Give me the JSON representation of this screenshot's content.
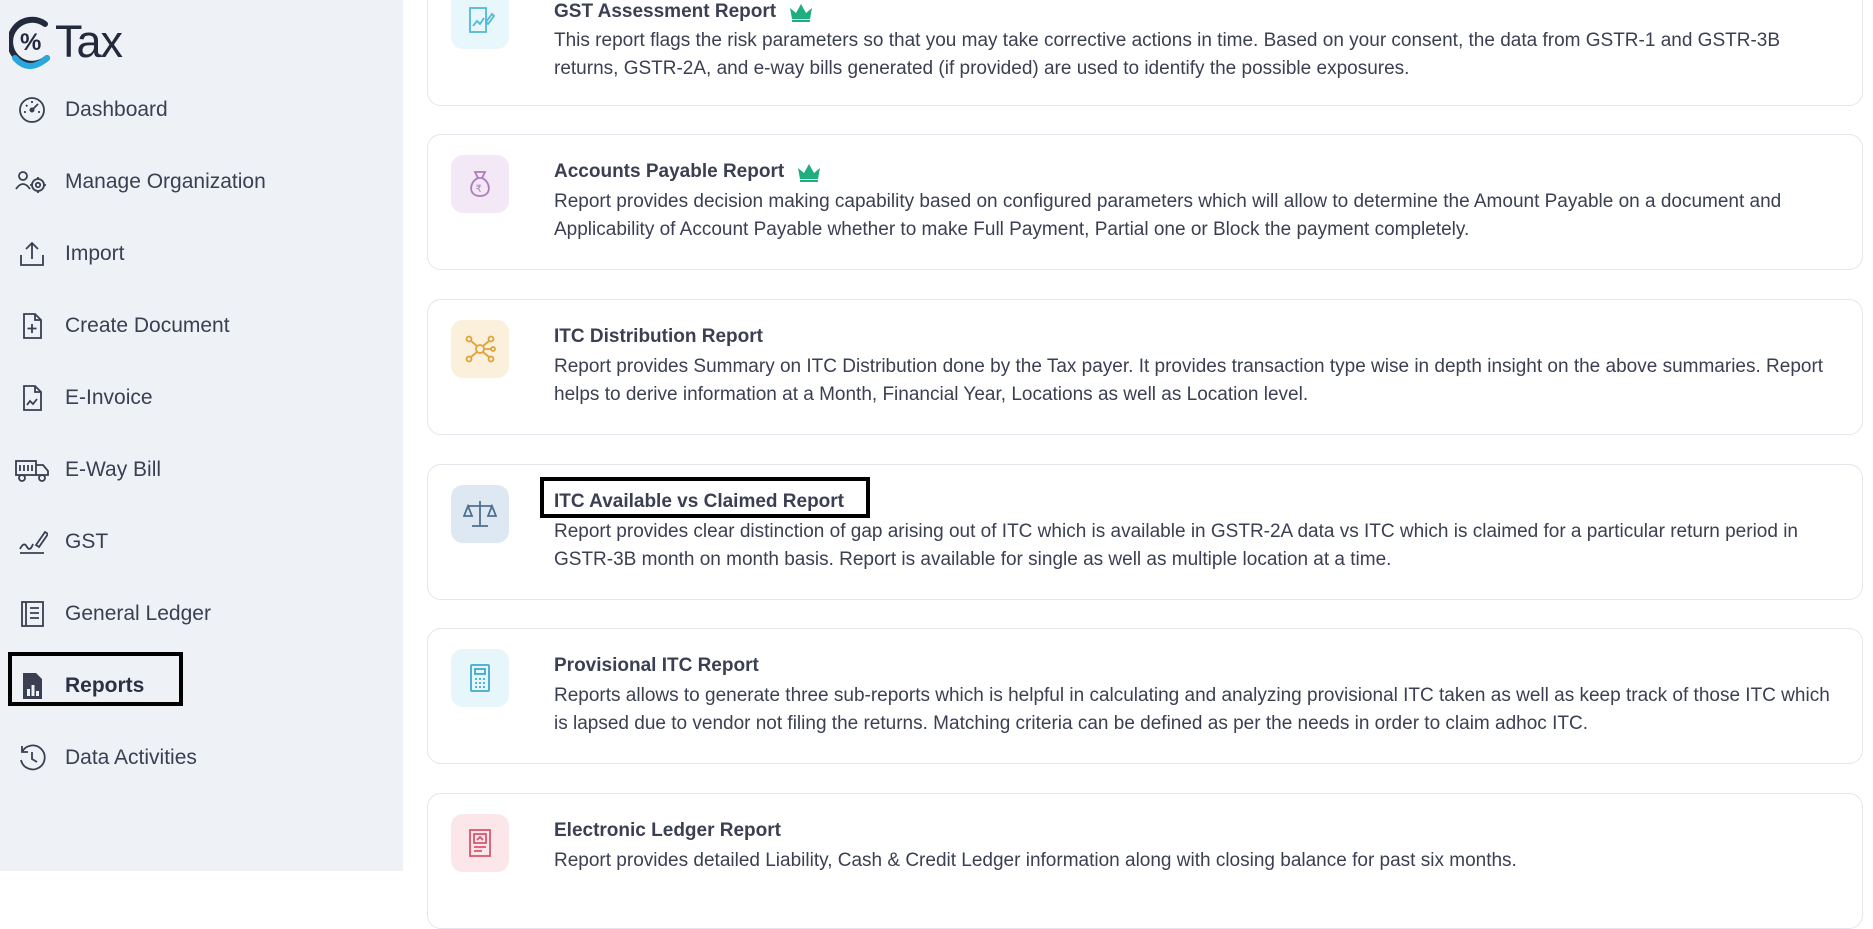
{
  "app": {
    "logo_text": "Tax",
    "logo_mark": "%"
  },
  "sidebar": {
    "items": [
      {
        "label": "Dashboard",
        "icon": "dashboard-gauge-icon"
      },
      {
        "label": "Manage Organization",
        "icon": "manage-organization-icon"
      },
      {
        "label": "Import",
        "icon": "import-upload-icon"
      },
      {
        "label": "Create Document",
        "icon": "create-document-icon"
      },
      {
        "label": "E-Invoice",
        "icon": "e-invoice-icon"
      },
      {
        "label": "E-Way Bill",
        "icon": "truck-icon"
      },
      {
        "label": "GST",
        "icon": "gst-signature-icon"
      },
      {
        "label": "General Ledger",
        "icon": "ledger-book-icon"
      },
      {
        "label": "Reports",
        "icon": "reports-chart-icon",
        "active": true
      },
      {
        "label": "Data Activities",
        "icon": "history-icon"
      }
    ]
  },
  "reports": [
    {
      "title": "GST Assessment Report",
      "premium": true,
      "icon": "chart-edit-icon",
      "accent": "#e8f7fb",
      "description": "This report flags the risk parameters so that you may take corrective actions in time. Based on your consent, the data from GSTR-1 and GSTR-3B returns, GSTR-2A, and e-way bills generated (if provided) are used to identify the possible exposures."
    },
    {
      "title": "Accounts Payable Report",
      "premium": true,
      "icon": "money-bag-icon",
      "accent": "#f3e8f6",
      "description": "Report provides decision making capability based on configured parameters which will allow to determine the Amount Payable on a document and Applicability of Account Payable whether to make Full Payment, Partial one or Block the payment completely."
    },
    {
      "title": "ITC Distribution Report",
      "premium": false,
      "icon": "distribution-network-icon",
      "accent": "#fbf0dc",
      "description": "Report provides Summary on ITC Distribution done by the Tax payer. It provides transaction type wise in depth insight on the above summaries. Report helps to derive information at a Month, Financial Year, Locations as well as Location level."
    },
    {
      "title": "ITC Available vs Claimed Report",
      "premium": false,
      "icon": "balance-scale-icon",
      "accent": "#dde8f2",
      "description": "Report provides clear distinction of gap arising out of ITC which is available in GSTR-2A data vs ITC which is claimed for a particular return period in GSTR-3B month on month basis. Report is available for single as well as multiple location at a time."
    },
    {
      "title": "Provisional ITC Report",
      "premium": false,
      "icon": "calculator-document-icon",
      "accent": "#e6f6fb",
      "description": "Reports allows to generate three sub-reports which is helpful in calculating and analyzing provisional ITC taken as well as keep track of those ITC which is lapsed due to vendor not filing the returns. Matching criteria can be defined as per the needs in order to claim adhoc ITC."
    },
    {
      "title": "Electronic Ledger Report",
      "premium": false,
      "icon": "electronic-ledger-icon",
      "accent": "#fbe6ea",
      "description": "Report provides detailed Liability, Cash & Credit Ledger information along with closing balance for past six months."
    }
  ],
  "colors": {
    "crown": "#1fae7e",
    "sidebar_bg": "#eef1f5",
    "highlight_border": "#000000"
  }
}
